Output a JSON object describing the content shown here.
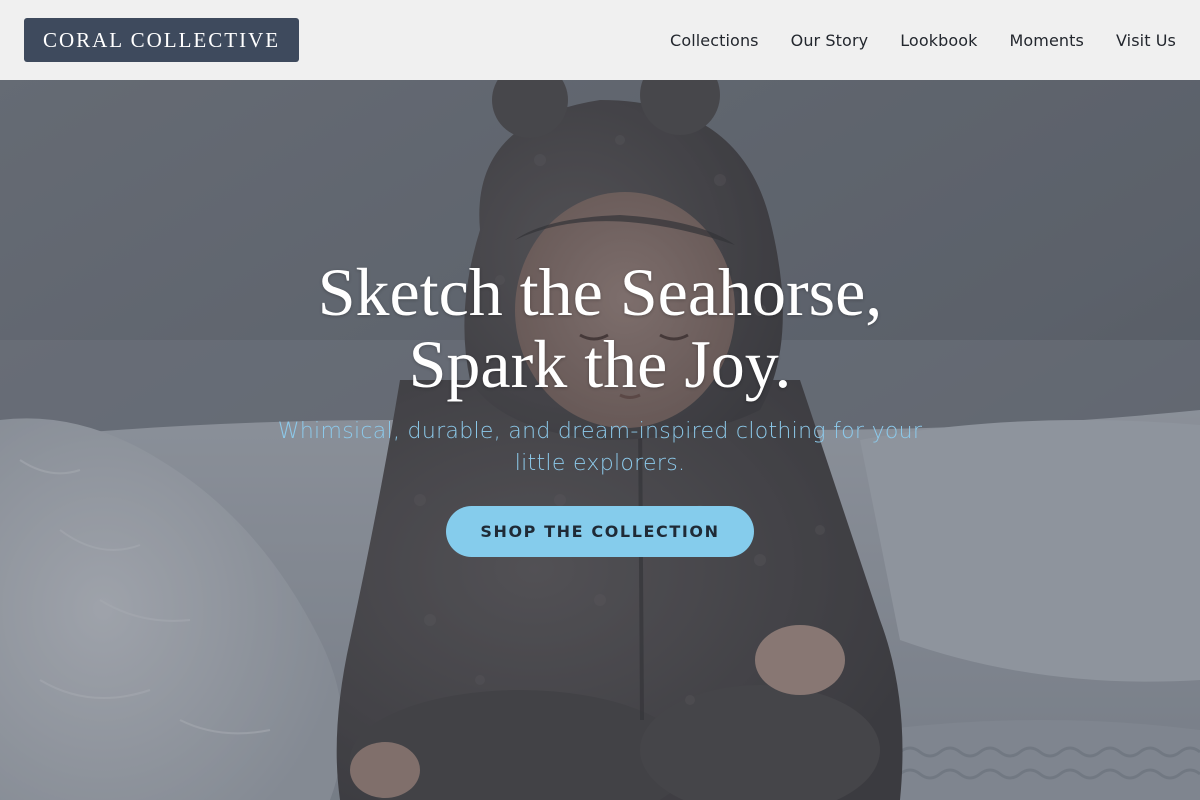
{
  "brand": {
    "name": "CORAL COLLECTIVE"
  },
  "nav": {
    "items": [
      {
        "label": "Collections"
      },
      {
        "label": "Our Story"
      },
      {
        "label": "Lookbook"
      },
      {
        "label": "Moments"
      },
      {
        "label": "Visit Us"
      }
    ]
  },
  "hero": {
    "title_line1": "Sketch the Seahorse,",
    "title_line2": "Spark the Joy.",
    "subtitle": "Whimsical, durable, and dream-inspired clothing for your little explorers.",
    "cta_label": "SHOP THE COLLECTION",
    "image": "baby in fuzzy grey bear-ear hooded suit sitting on white bed"
  },
  "colors": {
    "header_bg": "#f0f0f0",
    "logo_bg": "#3e4a5d",
    "accent": "#85ccec",
    "subtitle": "#8cc9ea",
    "nav_text": "#23272e"
  }
}
